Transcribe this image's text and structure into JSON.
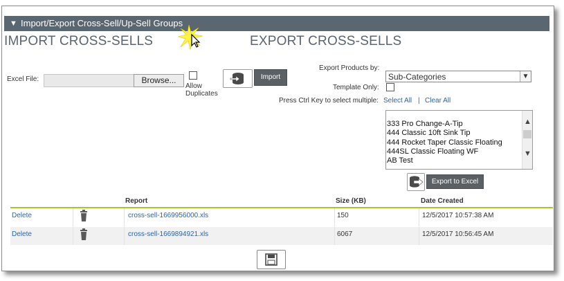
{
  "header": {
    "title": "Import/Export Cross-Sell/Up-Sell Groups"
  },
  "import": {
    "title": "IMPORT CROSS-SELLS",
    "excel_file_label": "Excel File:",
    "browse_label": "Browse...",
    "allow_label_1": "Allow",
    "allow_label_2": "Duplicates",
    "import_label": "Import"
  },
  "export": {
    "title": "EXPORT CROSS-SELLS",
    "export_products_label": "Export Products by:",
    "export_products_value": "Sub-Categories",
    "template_only_label": "Template Only:",
    "ctrl_hint": "Press Ctrl Key to select multiple:",
    "select_all": "Select All",
    "divider": "|",
    "clear_all": "Clear All",
    "list_items": [
      "333 Pro Change-A-Tip",
      "444 Classic 10ft Sink Tip",
      "444 Rocket Taper Classic Floating",
      "444SL Classic Floating WF",
      "AB Test"
    ],
    "export_label": "Export to Excel"
  },
  "table": {
    "headers": {
      "report": "Report",
      "size": "Size (KB)",
      "date": "Date Created"
    },
    "rows": [
      {
        "action": "Delete",
        "report": "cross-sell-1669956000.xls",
        "size": "150",
        "date": "12/5/2017 10:57:38 AM"
      },
      {
        "action": "Delete",
        "report": "cross-sell-1669894921.xls",
        "size": "6067",
        "date": "12/5/2017 10:56:45 AM"
      }
    ]
  },
  "icons": {
    "collapse": "chevron-down-icon",
    "import": "database-import-icon",
    "export": "database-export-icon",
    "delete": "trash-icon",
    "save": "floppy-disk-icon",
    "dropdown": "chevron-down-icon"
  },
  "colors": {
    "header_bg": "#5b6770",
    "accent_line": "#a6c826",
    "link": "#2a63a8",
    "button_dark": "#5b6064"
  }
}
